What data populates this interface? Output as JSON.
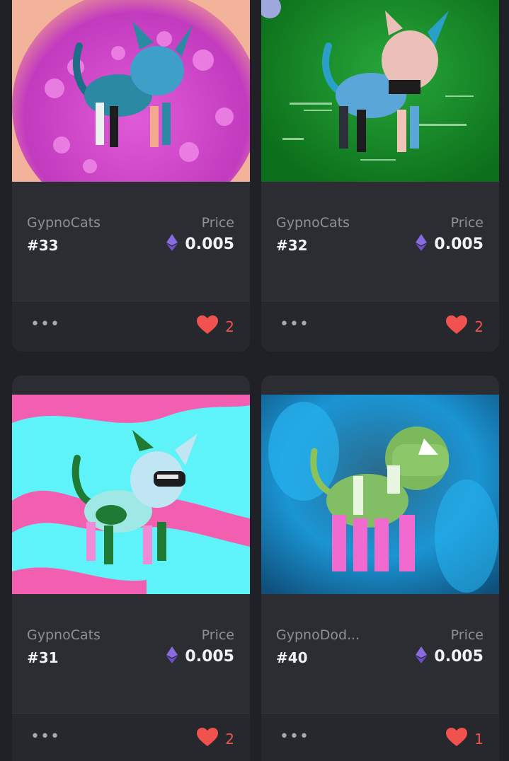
{
  "price_label": "Price",
  "more_label": "•••",
  "colors": {
    "heart": "#f0524f",
    "eth": "#7b5cd6",
    "card_bg": "#2b2d33",
    "footer_bg": "#26282d"
  },
  "icons": {
    "currency": "ethereum-icon",
    "like": "heart-icon",
    "more": "more-options-icon"
  },
  "cards": [
    {
      "collection": "GypnoCats",
      "token": "#33",
      "price": "0.005",
      "likes": "2"
    },
    {
      "collection": "GypnoCats",
      "token": "#32",
      "price": "0.005",
      "likes": "2"
    },
    {
      "collection": "GypnoCats",
      "token": "#31",
      "price": "0.005",
      "likes": "2"
    },
    {
      "collection": "GypnoDod...",
      "token": "#40",
      "price": "0.005",
      "likes": "1"
    }
  ]
}
